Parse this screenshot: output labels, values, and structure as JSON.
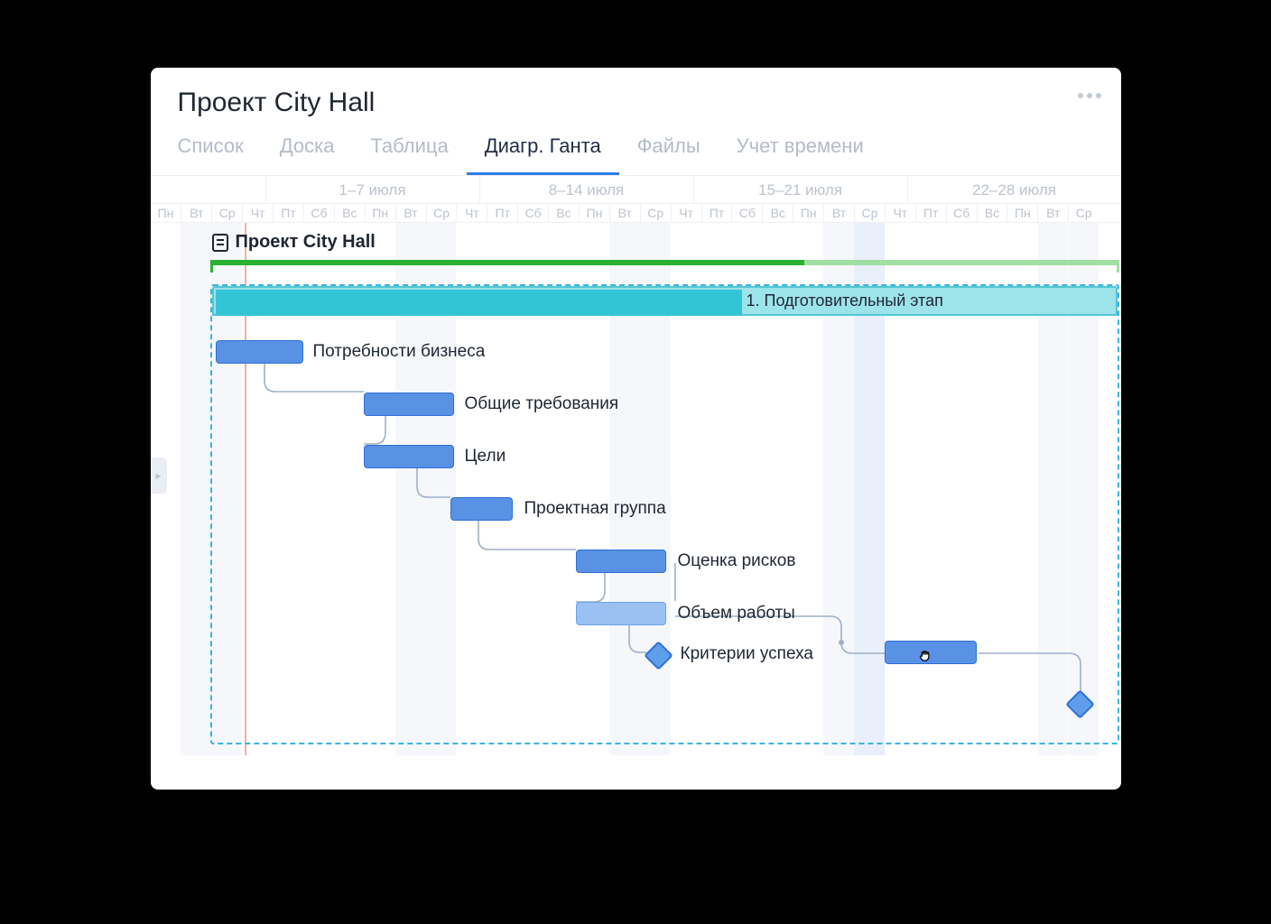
{
  "header": {
    "title": "Проект City Hall"
  },
  "tabs": [
    {
      "label": "Список",
      "active": false
    },
    {
      "label": "Доска",
      "active": false
    },
    {
      "label": "Таблица",
      "active": false
    },
    {
      "label": "Диагр. Ганта",
      "active": true
    },
    {
      "label": "Файлы",
      "active": false
    },
    {
      "label": "Учет времени",
      "active": false
    }
  ],
  "timeline": {
    "weeks": [
      "",
      "1–7 июля",
      "8–14 июля",
      "15–21 июля",
      "22–28 июля"
    ],
    "days": [
      "Пн",
      "Вт",
      "Ср",
      "Чт",
      "Пт",
      "Сб",
      "Вс",
      "Пн",
      "Вт",
      "Ср",
      "Чт",
      "Пт",
      "Сб",
      "Вс",
      "Пн",
      "Вт",
      "Ср",
      "Чт",
      "Пт",
      "Сб",
      "Вс",
      "Пн",
      "Вт",
      "Ср",
      "Чт",
      "Пт",
      "Сб",
      "Вс",
      "Пн",
      "Вт",
      "Ср"
    ]
  },
  "project": {
    "name": "Проект City Hall"
  },
  "stage": {
    "label": "1. Подготовительный этап"
  },
  "tasks": [
    {
      "label": "Потребности бизнеса"
    },
    {
      "label": "Общие требования"
    },
    {
      "label": "Цели"
    },
    {
      "label": "Проектная группа"
    },
    {
      "label": "Оценка рисков"
    },
    {
      "label": "Объем работы"
    },
    {
      "label": "Критерии успеха"
    }
  ],
  "chart_data": {
    "type": "gantt",
    "xlabel": "июль",
    "x_days": [
      "Пн",
      "Вт",
      "Ср",
      "Чт",
      "Пт",
      "Сб",
      "Вс",
      "Пн",
      "Вт",
      "Ср",
      "Чт",
      "Пт",
      "Сб",
      "Вс",
      "Пн",
      "Вт",
      "Ср",
      "Чт",
      "Пт",
      "Сб",
      "Вс",
      "Пн",
      "Вт",
      "Ср",
      "Чт",
      "Пт",
      "Сб",
      "Вс",
      "Пн",
      "Вт",
      "Ср"
    ],
    "week_ranges": [
      "1–7 июля",
      "8–14 июля",
      "15–21 июля",
      "22–28 июля"
    ],
    "today_index": 3,
    "highlighted_index": 23,
    "project_span": {
      "start": 2,
      "end": 31,
      "progress_end": 21
    },
    "stage": {
      "name": "1. Подготовительный этап",
      "start": 2,
      "end": 31,
      "progress_end": 19
    },
    "tasks": [
      {
        "name": "Потребности бизнеса",
        "start": 2,
        "end": 4,
        "type": "bar",
        "depends_on": null
      },
      {
        "name": "Общие требования",
        "start": 7,
        "end": 9,
        "type": "bar",
        "depends_on": "Потребности бизнеса"
      },
      {
        "name": "Цели",
        "start": 7,
        "end": 9,
        "type": "bar",
        "depends_on": "Общие требования"
      },
      {
        "name": "Проектная группа",
        "start": 10,
        "end": 11,
        "type": "bar",
        "depends_on": "Цели"
      },
      {
        "name": "Оценка рисков",
        "start": 14,
        "end": 16,
        "type": "bar",
        "depends_on": "Проектная группа"
      },
      {
        "name": "Объем работы",
        "start": 14,
        "end": 16,
        "type": "bar",
        "depends_on": "Оценка рисков",
        "light": true
      },
      {
        "name": "Критерии успеха",
        "start": 16,
        "end": 16,
        "type": "milestone",
        "depends_on": "Объем работы"
      },
      {
        "name": "",
        "start": 22,
        "end": 24,
        "type": "bar",
        "depends_on": "Объем работы",
        "dragging": true
      },
      {
        "name": "",
        "start": 28,
        "end": 28,
        "type": "milestone",
        "depends_on": 7
      }
    ]
  }
}
